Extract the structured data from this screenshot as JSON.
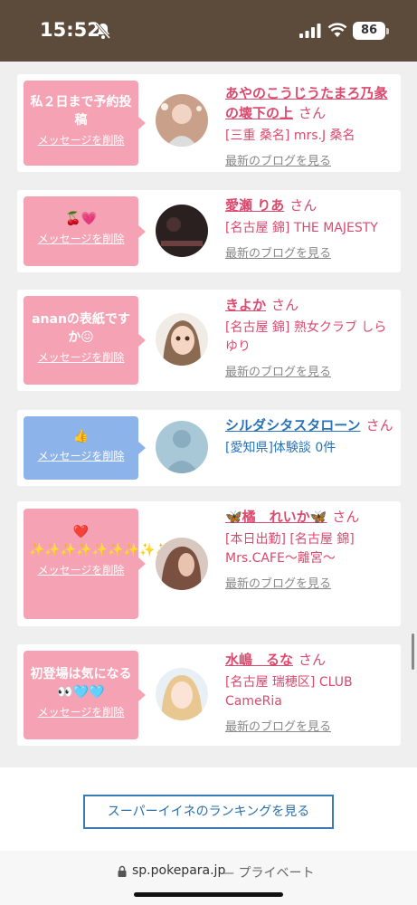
{
  "status_bar": {
    "time": "15:52",
    "battery": "86",
    "icons": [
      "bell-slash-icon",
      "signal-icon",
      "wifi-icon",
      "battery-icon"
    ]
  },
  "cards": [
    {
      "message": "私２日まで予約投稿",
      "delete": "メッセージを削除",
      "name": "あやのこうじうたまろ乃彖の壊下の上",
      "san": "さん",
      "detail": "[三重 桑名] mrs.J 桑名",
      "link": "最新のブログを見る"
    },
    {
      "message": "🍒💗",
      "delete": "メッセージを削除",
      "name": "愛瀬 りあ",
      "san": "さん",
      "detail": "[名古屋 錦] THE MAJESTY",
      "link": "最新のブログを見る"
    },
    {
      "message": "ananの表紙ですか😖",
      "delete": "メッセージを削除",
      "name": "きよか",
      "san": "さん",
      "detail": "[名古屋 錦] 熟女クラブ しらゆり",
      "link": "最新のブログを見る"
    },
    {
      "message": "👍",
      "delete": "メッセージを削除",
      "name": "シルダシタスタローン",
      "san": "さん",
      "detail": "[愛知県]体験談 0件",
      "link": ""
    },
    {
      "message": "❤️ ✨✨✨✨✨✨✨✨✨✨",
      "delete": "メッセージを削除",
      "name": "🦋橘　れいか🦋",
      "san": "さん",
      "detail": "[本日出勤] [名古屋 錦] Mrs.CAFE〜離宮〜",
      "link": "最新のブログを見る"
    },
    {
      "message": "初登場は気になる👀🩵🩵",
      "delete": "メッセージを削除",
      "name": "水嶋　るな",
      "san": "さん",
      "detail": "[名古屋 瑞穂区] CLUB CameRia",
      "link": "最新のブログを見る"
    }
  ],
  "ranking_button": "スーパーイイネのランキングを見る",
  "url_bar": {
    "domain": "sp.pokepara.jp",
    "suffix": "— プライベート"
  }
}
